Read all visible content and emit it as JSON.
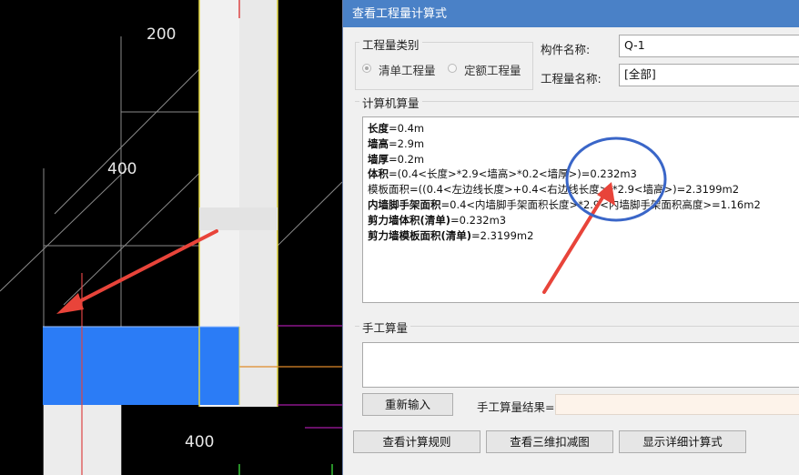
{
  "cad": {
    "dims": [
      "200",
      "400",
      "400"
    ]
  },
  "dialog": {
    "title": "查看工程量计算式",
    "category": {
      "title": "工程量类别",
      "options": [
        {
          "label": "清单工程量",
          "selected": true
        },
        {
          "label": "定额工程量",
          "selected": false
        }
      ]
    },
    "component_label": "构件名称:",
    "component_value": "Q-1",
    "quantity_label": "工程量名称:",
    "quantity_value": "[全部]",
    "computer_section": "计算机算量",
    "calc_lines": [
      {
        "key": "长度",
        "rest": "=0.4m"
      },
      {
        "key": "墙高",
        "rest": "=2.9m"
      },
      {
        "key": "墙厚",
        "rest": "=0.2m"
      },
      {
        "key": "体积",
        "rest": "=(0.4<长度>*2.9<墙高>*0.2<墙厚>)=0.232m3"
      },
      {
        "key": "",
        "rest": "模板面积=((0.4<左边线长度>+0.4<右边线长度>)*2.9<墙高>)=2.3199m2"
      },
      {
        "key": "内墙脚手架面积",
        "rest": "=0.4<内墙脚手架面积长度>*2.9<内墙脚手架面积高度>=1.16m2"
      },
      {
        "key": "剪力墙体积(清单)",
        "rest": "=0.232m3"
      },
      {
        "key": "剪力墙模板面积(清单)",
        "rest": "=2.3199m2"
      }
    ],
    "manual_section": "手工算量",
    "reenter_button": "重新输入",
    "manual_result_label": "手工算量结果=",
    "buttons": {
      "rules": "查看计算规则",
      "view3d": "查看三维扣减图",
      "detail": "显示详细计算式"
    }
  },
  "colors": {
    "titlebar": "#4a81c7",
    "annotation": "#e8443a",
    "circle": "#3a66c8",
    "cad_fill": "#2b7cf6"
  }
}
